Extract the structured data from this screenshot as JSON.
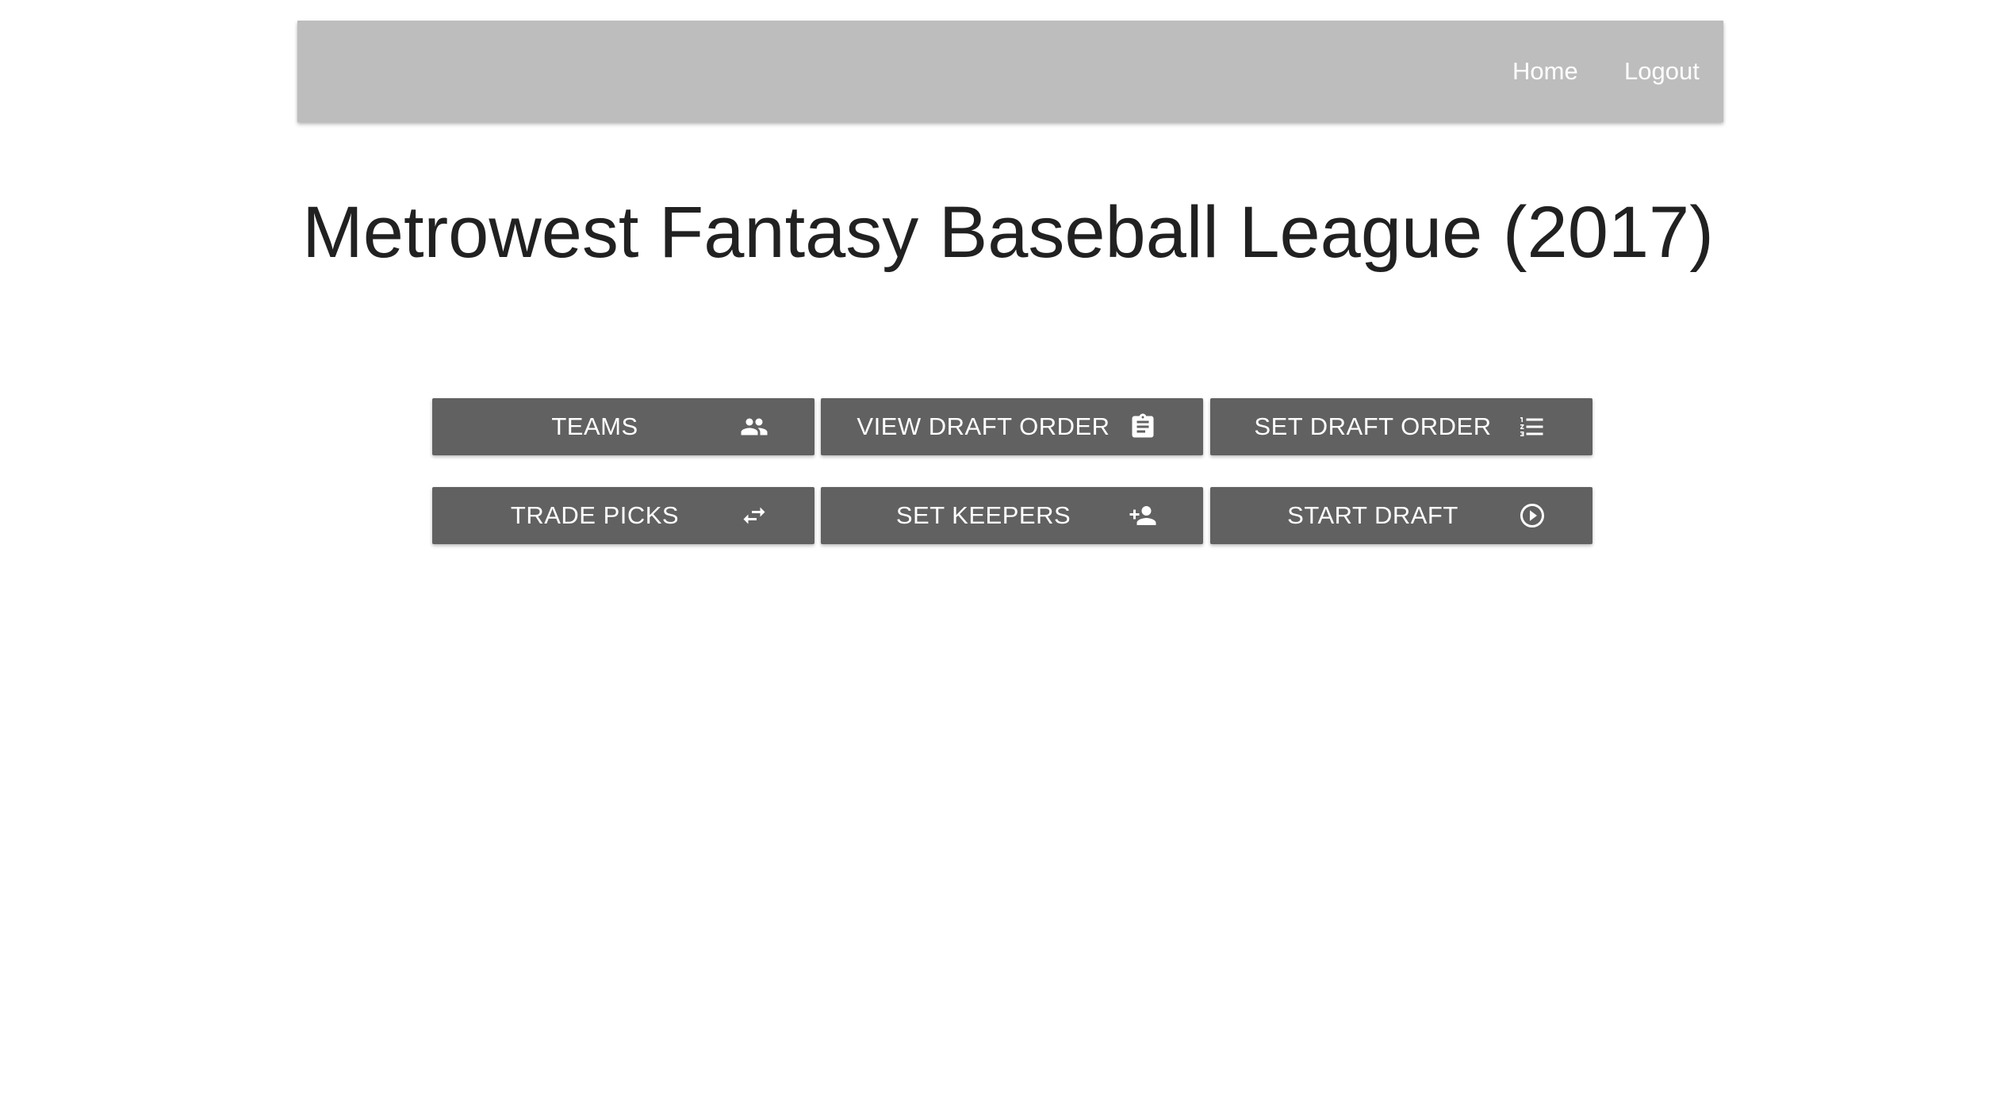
{
  "navbar": {
    "links": [
      {
        "label": "Home"
      },
      {
        "label": "Logout"
      }
    ]
  },
  "page": {
    "title": "Metrowest Fantasy Baseball League (2017)"
  },
  "actions": [
    {
      "label": "TEAMS",
      "icon": "people-icon"
    },
    {
      "label": "VIEW DRAFT ORDER",
      "icon": "clipboard-icon"
    },
    {
      "label": "SET DRAFT ORDER",
      "icon": "numbered-list-icon"
    },
    {
      "label": "TRADE PICKS",
      "icon": "swap-arrows-icon"
    },
    {
      "label": "SET KEEPERS",
      "icon": "add-person-icon"
    },
    {
      "label": "START DRAFT",
      "icon": "play-circle-icon"
    }
  ],
  "colors": {
    "navbar_bg": "#bdbdbd",
    "button_bg": "#616161",
    "title_text": "#212121",
    "button_text": "#ffffff"
  }
}
